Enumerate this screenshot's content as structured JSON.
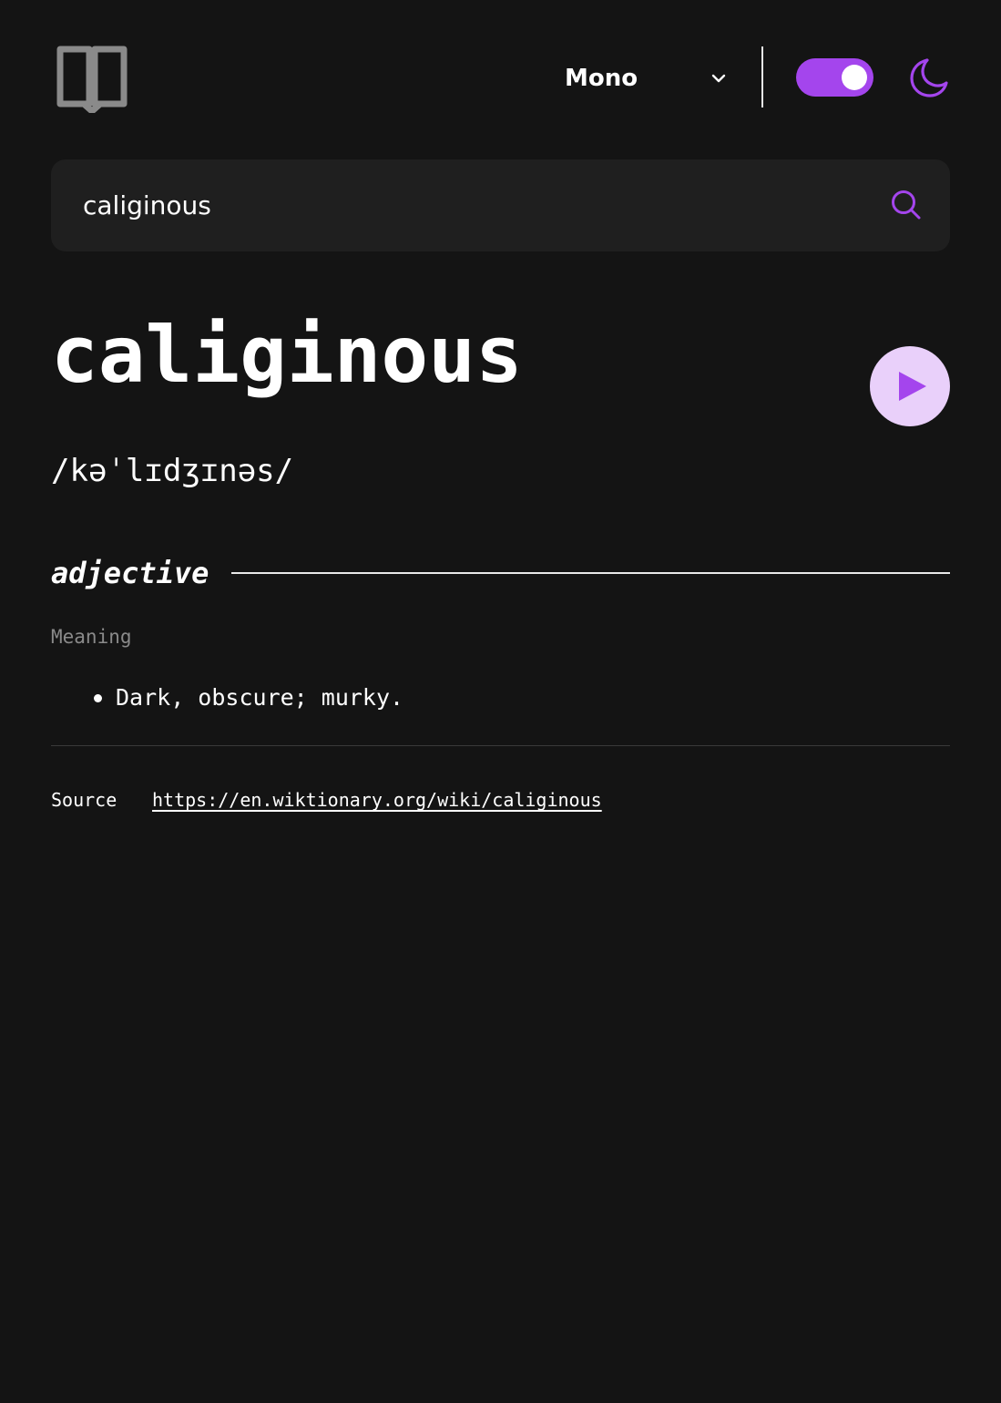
{
  "header": {
    "logo_icon": "book-icon",
    "font_select": {
      "selected": "Mono",
      "icon": "chevron-down-icon"
    },
    "theme_toggle": {
      "on": true
    },
    "theme_icon": "moon-icon"
  },
  "search": {
    "value": "caliginous",
    "icon": "search-icon"
  },
  "entry": {
    "word": "caliginous",
    "phonetic": "/kəˈlɪdʒɪnəs/",
    "play_icon": "play-icon",
    "meanings": [
      {
        "part_of_speech": "adjective",
        "meaning_label": "Meaning",
        "definitions": [
          "Dark, obscure; murky."
        ]
      }
    ],
    "source": {
      "label": "Source",
      "url": "https://en.wiktionary.org/wiki/caliginous"
    }
  },
  "colors": {
    "background": "#141414",
    "surface": "#1f1f1f",
    "accent": "#a445ed",
    "accent_light": "#e9d0fa",
    "muted_text": "#8a8a8a",
    "text": "#ffffff"
  }
}
